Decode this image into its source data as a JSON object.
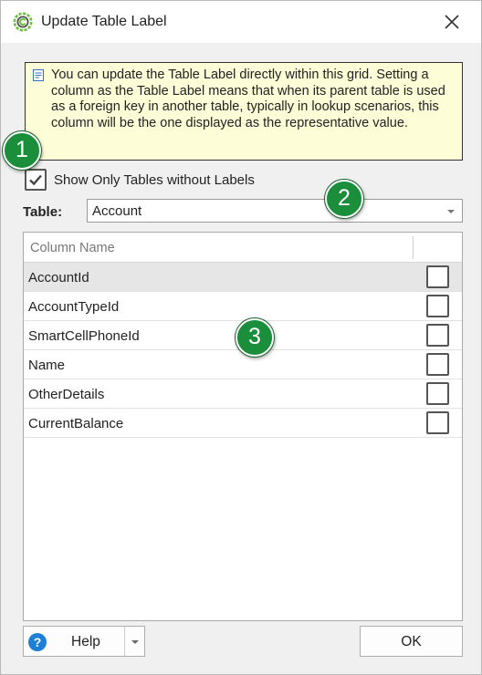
{
  "window": {
    "title": "Update Table Label",
    "close_icon": "close-icon"
  },
  "info": {
    "icon": "note-icon",
    "text": "You can update the Table Label directly within this grid. Setting a column as the Table Label means that when its parent table is used as a foreign key in another table, typically in lookup scenarios, this column will be the one displayed as the representative value."
  },
  "filter": {
    "label": "Show Only Tables without Labels",
    "checked": true
  },
  "table_select": {
    "label": "Table:",
    "value": "Account"
  },
  "grid": {
    "header": "Column Name",
    "rows": [
      {
        "name": "AccountId",
        "checked": false,
        "selected": true
      },
      {
        "name": "AccountTypeId",
        "checked": false,
        "selected": false
      },
      {
        "name": "SmartCellPhoneId",
        "checked": false,
        "selected": false
      },
      {
        "name": "Name",
        "checked": false,
        "selected": false
      },
      {
        "name": "OtherDetails",
        "checked": false,
        "selected": false
      },
      {
        "name": "CurrentBalance",
        "checked": false,
        "selected": false
      }
    ]
  },
  "footer": {
    "help_label": "Help",
    "help_icon_glyph": "?",
    "ok_label": "OK"
  },
  "callouts": [
    "1",
    "2",
    "3"
  ],
  "colors": {
    "callout": "#1a8e3a",
    "info_background": "#fdfdd7",
    "help_icon": "#1e7fd6",
    "app_icon": "#6cbf3c"
  }
}
